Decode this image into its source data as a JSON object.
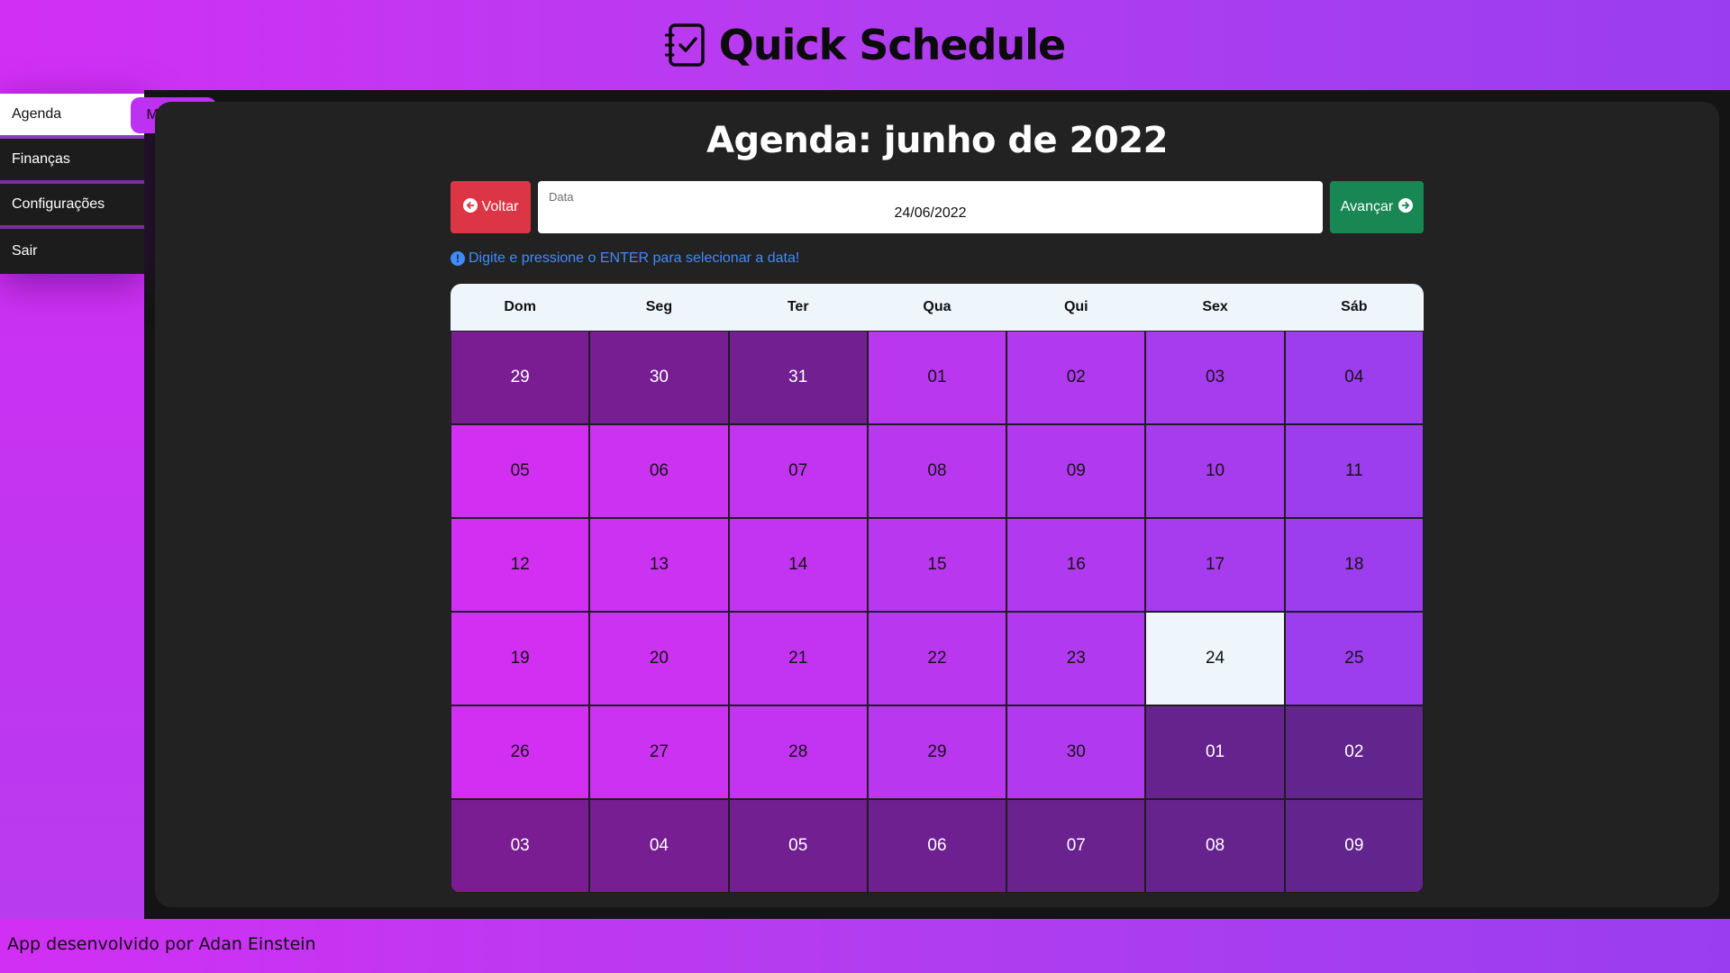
{
  "header": {
    "title": "Quick Schedule",
    "logo_icon": "checklist-notebook-icon"
  },
  "sidebar": {
    "menu_button": {
      "label": "Menu",
      "icon": "hamburger-icon"
    },
    "items": [
      {
        "label": "Agenda",
        "active": true
      },
      {
        "label": "Finanças",
        "active": false
      },
      {
        "label": "Configurações",
        "active": false
      },
      {
        "label": "Sair",
        "active": false
      }
    ]
  },
  "main": {
    "title": "Agenda: junho de 2022",
    "back_button": "Voltar",
    "next_button": "Avançar",
    "date_field": {
      "label": "Data",
      "value": "24/06/2022"
    },
    "hint": "Digite e pressione o ENTER para selecionar a data!"
  },
  "calendar": {
    "weekdays": [
      "Dom",
      "Seg",
      "Ter",
      "Qua",
      "Qui",
      "Sex",
      "Sáb"
    ],
    "selected_day": "24",
    "weeks": [
      [
        {
          "d": "29",
          "other": true
        },
        {
          "d": "30",
          "other": true
        },
        {
          "d": "31",
          "other": true
        },
        {
          "d": "01"
        },
        {
          "d": "02"
        },
        {
          "d": "03"
        },
        {
          "d": "04"
        }
      ],
      [
        {
          "d": "05"
        },
        {
          "d": "06"
        },
        {
          "d": "07"
        },
        {
          "d": "08"
        },
        {
          "d": "09"
        },
        {
          "d": "10"
        },
        {
          "d": "11"
        }
      ],
      [
        {
          "d": "12"
        },
        {
          "d": "13"
        },
        {
          "d": "14"
        },
        {
          "d": "15"
        },
        {
          "d": "16"
        },
        {
          "d": "17"
        },
        {
          "d": "18"
        }
      ],
      [
        {
          "d": "19"
        },
        {
          "d": "20"
        },
        {
          "d": "21"
        },
        {
          "d": "22"
        },
        {
          "d": "23"
        },
        {
          "d": "24",
          "today": true
        },
        {
          "d": "25"
        }
      ],
      [
        {
          "d": "26"
        },
        {
          "d": "27"
        },
        {
          "d": "28"
        },
        {
          "d": "29"
        },
        {
          "d": "30"
        },
        {
          "d": "01",
          "other": true
        },
        {
          "d": "02",
          "other": true
        }
      ],
      [
        {
          "d": "03",
          "other": true
        },
        {
          "d": "04",
          "other": true
        },
        {
          "d": "05",
          "other": true
        },
        {
          "d": "06",
          "other": true
        },
        {
          "d": "07",
          "other": true
        },
        {
          "d": "08",
          "other": true
        },
        {
          "d": "09",
          "other": true
        }
      ]
    ],
    "colors": {
      "current_month_columns": [
        "#d32ff3",
        "#cb32f2",
        "#c234f1",
        "#ba37f0",
        "#b139ef",
        "#a73bee",
        "#9c3dee"
      ],
      "other_month_columns": [
        "#7a1d93",
        "#761e92",
        "#721f91",
        "#6e2090",
        "#6a228f",
        "#66238e",
        "#62248d"
      ]
    }
  },
  "footer": {
    "text": "App desenvolvido por Adan Einstein"
  }
}
